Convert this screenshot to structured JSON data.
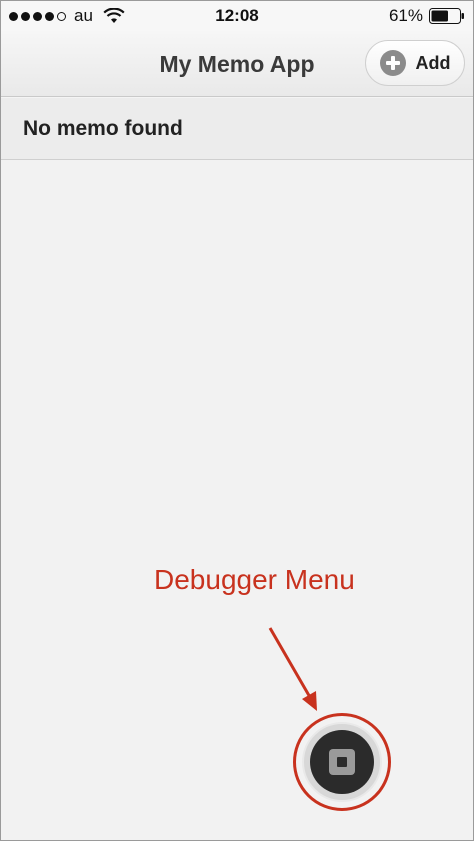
{
  "status_bar": {
    "carrier": "au",
    "time": "12:08",
    "battery_percent": "61%",
    "signal_bars_filled": 4,
    "signal_bars_total": 5,
    "battery_level": 0.61
  },
  "nav": {
    "title": "My Memo App",
    "add_label": "Add",
    "add_icon": "plus-circle-icon"
  },
  "list": {
    "empty_message": "No memo found"
  },
  "annotation": {
    "label": "Debugger Menu",
    "color": "#c8321e"
  },
  "debugger": {
    "icon": "stop-square-icon"
  }
}
